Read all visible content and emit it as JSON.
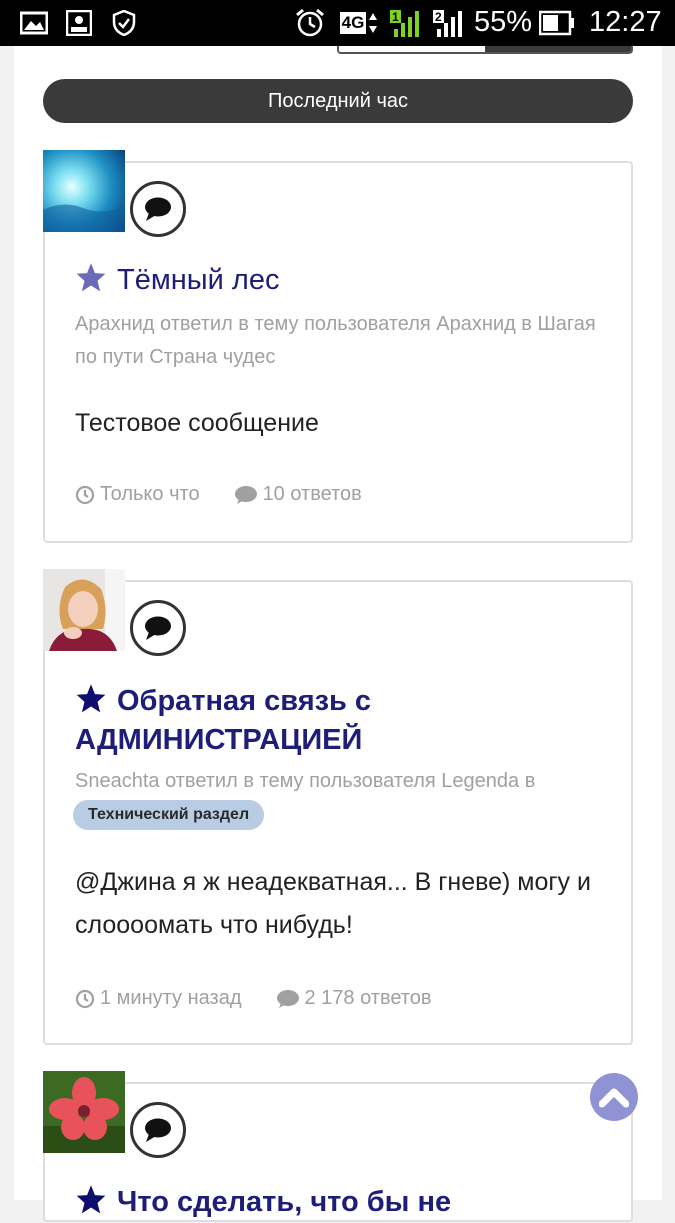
{
  "status_bar": {
    "battery_percent": "55%",
    "time": "12:27",
    "network": "4G",
    "sim1": "1",
    "sim2": "2"
  },
  "filter": {
    "label": "Последний час"
  },
  "posts": [
    {
      "title": "Тёмный лес",
      "meta": "Арахнид ответил в тему пользователя Арахнид в Шагая по пути Страна чудес",
      "body": "Тестовое сообщение",
      "time": "Только что",
      "replies": "10 ответов",
      "star_color": "#6a6ab8"
    },
    {
      "title": "Обратная связь с АДМИНИСТРАЦИЕЙ",
      "meta": "Sneachta ответил в тему пользователя Legenda в",
      "tag": "Технический раздел",
      "body": "@Джина я ж неадекватная... В гневе) могу и слоооомать что нибудь!",
      "time": "1 минуту назад",
      "replies": "2 178 ответов",
      "star_color": "#0e0e6e"
    },
    {
      "title": "Что сделать, что бы не",
      "star_color": "#0e0e6e"
    }
  ],
  "colors": {
    "title": "#1e1e7a",
    "meta": "#a0a0a0",
    "pill": "#3a3a3a",
    "tag_bg": "#b8cce4",
    "scroll_button": "#8f92d3"
  }
}
